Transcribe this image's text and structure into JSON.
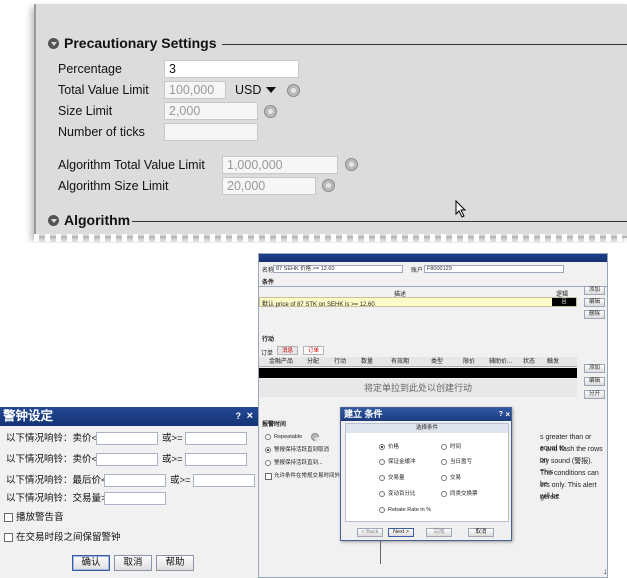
{
  "precautionary": {
    "section_title": "Precautionary Settings",
    "percentage_label": "Percentage",
    "percentage_value": "3",
    "total_value_limit_label": "Total Value Limit",
    "total_value_limit_value": "100,000",
    "currency": "USD",
    "size_limit_label": "Size Limit",
    "size_limit_value": "2,000",
    "number_of_ticks_label": "Number of ticks",
    "number_of_ticks_value": "",
    "algo_total_value_limit_label": "Algorithm Total Value Limit",
    "algo_total_value_limit_value": "1,000,000",
    "algo_size_limit_label": "Algorithm Size Limit",
    "algo_size_limit_value": "20,000",
    "algorithm_section_title": "Algorithm"
  },
  "order_window": {
    "name_label": "名称",
    "name_value": "87 SEHK 价格 >= 12.60",
    "account_label": "账户",
    "account_value": "F8000129",
    "conditions_header": "条件",
    "col_description": "描述",
    "col_logic": "逻辑",
    "condition_row": "默认 price of 87 STK on SEHK is >= 12.60",
    "condition_logic": "且",
    "add_button": "添加",
    "edit_button": "编辑",
    "delete_button": "删除",
    "action_header": "行动",
    "tab_message": "消息",
    "tab_order": "订单",
    "tabs_prefix": "订单",
    "order_cols": [
      "金融产品",
      "分配",
      "行动",
      "数量",
      "有效期",
      "类型",
      "限价",
      "辅助价...",
      "状态",
      "触发"
    ],
    "drag_hint": "将定单拉到此处以创建行动",
    "side_add": "添加",
    "side_edit": "编辑",
    "side_split": "分开",
    "alarm_time_label": "报警时间",
    "repeatable_label": "Repeatable",
    "opt_stay": "警报保持活跃直到取消",
    "opt_stay_until": "警报保持活跃直到...",
    "opt_outside": "允许条件在常规交易时间外...",
    "right_text": [
      "s greater than or equal to",
      "e and flash the rows on",
      "lay sound (警报). This",
      "The conditions can be",
      "ers only. This alert will be",
      "gered."
    ]
  },
  "condition_dialog": {
    "title": "建立 条件",
    "subtitle": "选择条件",
    "options": [
      {
        "label": "价格",
        "selected": true
      },
      {
        "label": "时间",
        "selected": false
      },
      {
        "label": "保证金缓冲",
        "selected": false
      },
      {
        "label": "当日盈亏",
        "selected": false
      },
      {
        "label": "交易量",
        "selected": false
      },
      {
        "label": "交易",
        "selected": false
      },
      {
        "label": "变动百分比",
        "selected": false
      },
      {
        "label": "同类交换票",
        "selected": false
      },
      {
        "label": "Rebate Rate in %",
        "selected": false
      }
    ],
    "back_button": "< Back",
    "next_button": "Next >",
    "finish_button": "完成",
    "cancel_button": "取消"
  },
  "alarm_dialog": {
    "title": "警钟设定",
    "row1_label": "以下情况响铃：卖价<=",
    "row1_mid": "或>=",
    "row2_label": "以下情况响铃：卖价<=",
    "row2_mid": "或>=",
    "row3_label": "以下情况响铃：最后价<=",
    "row3_mid": "或>=",
    "row4_label": "以下情况响铃：交易量>=",
    "check1_label": "播放警告音",
    "check2_label": "在交易时段之间保留警钟",
    "ok_button": "确认",
    "cancel_button": "取消",
    "help_button": "帮助"
  },
  "colors": {
    "title_bar": "#1b3a7b",
    "panel_bg": "#dcdcdc"
  }
}
